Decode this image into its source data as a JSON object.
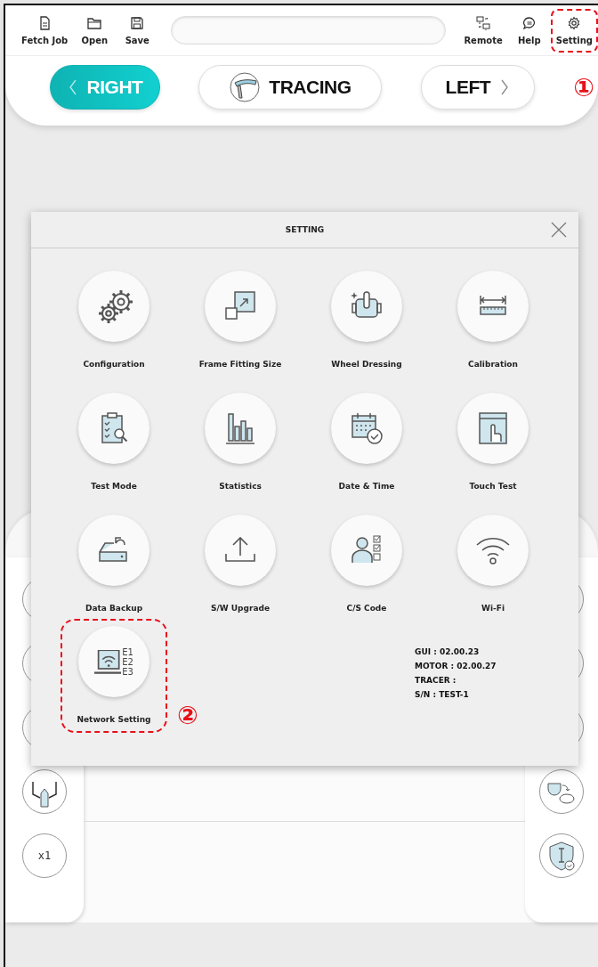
{
  "toolbar": {
    "left": [
      {
        "label": "Fetch Job",
        "highlighted": false
      },
      {
        "label": "Open",
        "highlighted": false
      },
      {
        "label": "Save",
        "highlighted": false
      }
    ],
    "right": [
      {
        "label": "Remote",
        "highlighted": false
      },
      {
        "label": "Help",
        "highlighted": false
      },
      {
        "label": "Setting",
        "highlighted": true
      }
    ]
  },
  "modes": [
    {
      "label": "RIGHT",
      "kind": "prev",
      "selected": true
    },
    {
      "label": "TRACING",
      "kind": "tool",
      "selected": false
    },
    {
      "label": "LEFT",
      "kind": "next",
      "selected": false
    }
  ],
  "callouts": [
    "①",
    "②"
  ],
  "side_tools": {
    "zoom_label": "x1"
  },
  "dialog": {
    "title": "SETTING",
    "items": [
      {
        "label": "Configuration",
        "highlighted": false
      },
      {
        "label": "Frame Fitting Size",
        "highlighted": false
      },
      {
        "label": "Wheel Dressing",
        "highlighted": false
      },
      {
        "label": "Calibration",
        "highlighted": false
      },
      {
        "label": "Test Mode",
        "highlighted": false
      },
      {
        "label": "Statistics",
        "highlighted": false
      },
      {
        "label": "Date & Time",
        "highlighted": false
      },
      {
        "label": "Touch Test",
        "highlighted": false
      },
      {
        "label": "Data Backup",
        "highlighted": false
      },
      {
        "label": "S/W Upgrade",
        "highlighted": false
      },
      {
        "label": "C/S Code",
        "highlighted": false
      },
      {
        "label": "Wi-Fi",
        "highlighted": false
      },
      {
        "label": "Network Setting",
        "highlighted": true,
        "icon_text": [
          "E1",
          "E2",
          "E3"
        ]
      }
    ],
    "info": [
      "GUI : 02.00.23",
      "MOTOR : 02.00.27",
      "TRACER :",
      "S/N : TEST-1"
    ]
  }
}
